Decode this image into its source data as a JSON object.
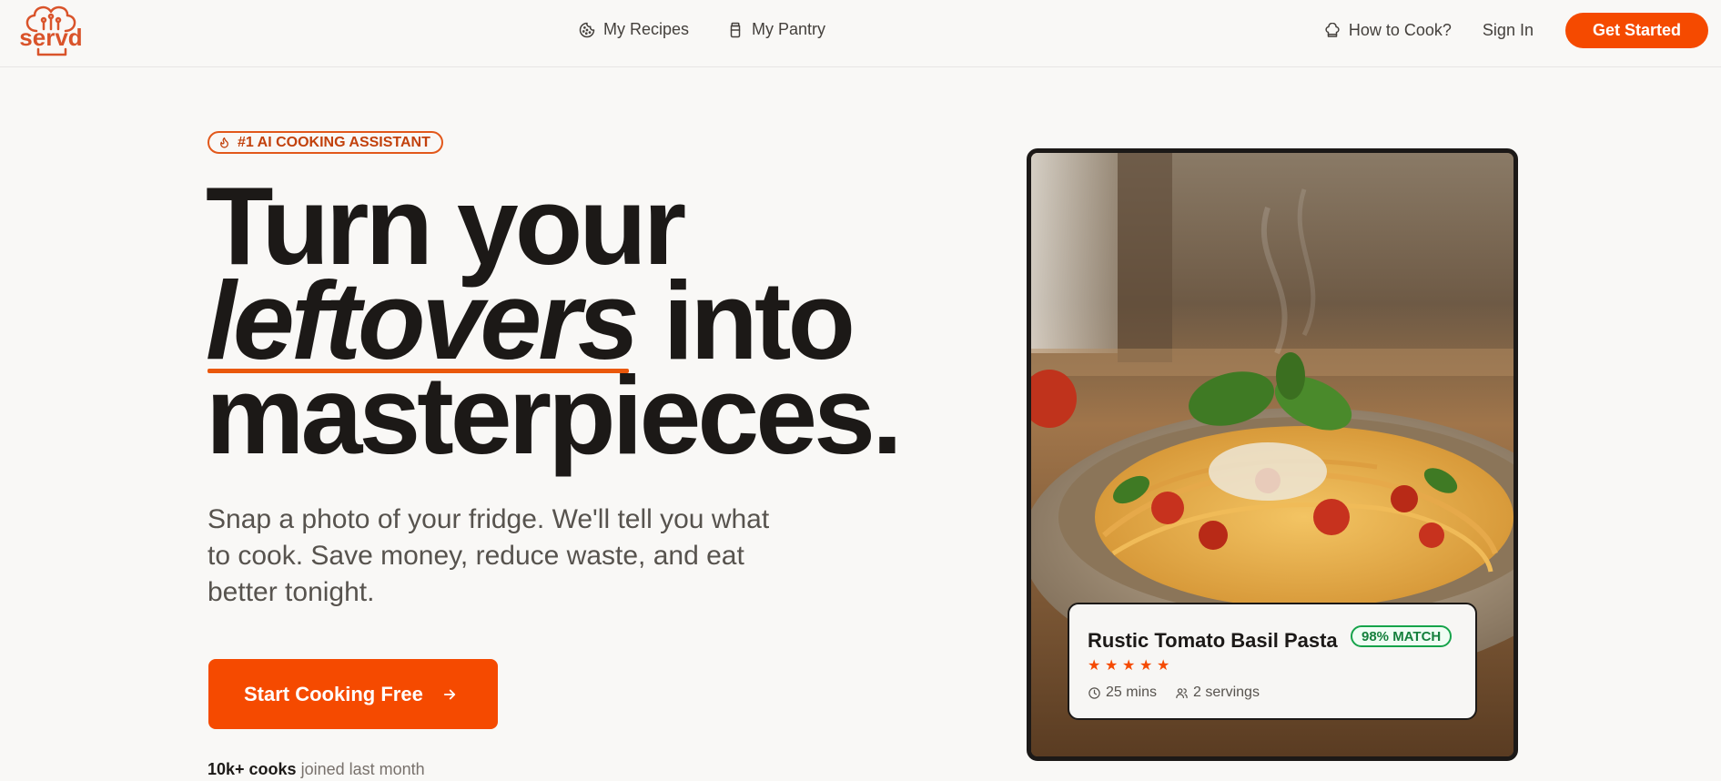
{
  "nav": {
    "logo_text": "servd",
    "links": [
      {
        "label": "My Recipes",
        "icon": "cookie-icon"
      },
      {
        "label": "My Pantry",
        "icon": "jar-icon"
      }
    ],
    "how_to": {
      "label": "How to Cook?",
      "icon": "chef-hat-icon"
    },
    "sign_in": "Sign In",
    "cta": "Get Started"
  },
  "hero": {
    "badge": "#1 AI COOKING ASSISTANT",
    "badge_icon": "flame-icon",
    "headline": {
      "line1": "Turn your",
      "line2_em": "leftovers",
      "line2_rest": " into",
      "line3": "masterpieces."
    },
    "subtext": "Snap a photo of your fridge. We'll tell you what to cook. Save money, reduce waste, and eat better tonight.",
    "cta": "Start Cooking Free",
    "joined_bold": "10k+ cooks",
    "joined_rest": " joined last month"
  },
  "recipe_card": {
    "title": "Rustic Tomato Basil Pasta",
    "match": "98% MATCH",
    "rating": 5,
    "time": "25 mins",
    "servings": "2 servings"
  },
  "colors": {
    "accent": "#f54a00",
    "match_green": "#15803d",
    "text": "#1c1917",
    "background": "#f9f8f6"
  }
}
